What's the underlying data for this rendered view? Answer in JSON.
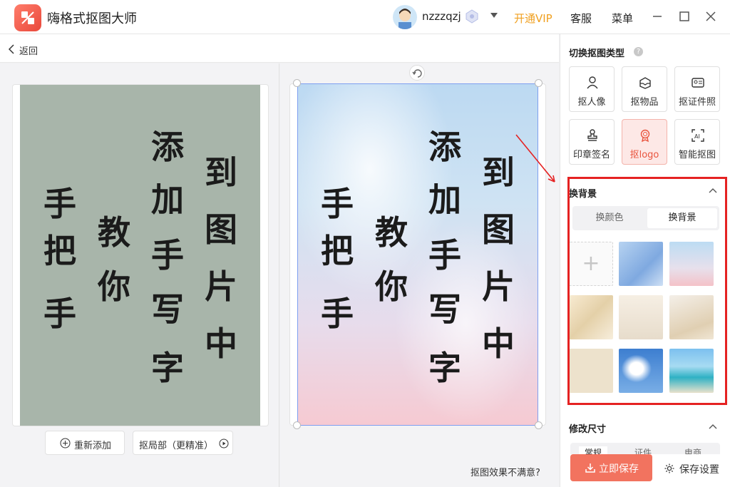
{
  "app": {
    "title": "嗨格式抠图大师",
    "username": "nzzzqzj",
    "vip_label": "开通VIP",
    "service_label": "客服",
    "menu_label": "菜单"
  },
  "nav": {
    "back_label": "返回"
  },
  "canvas": {
    "original_text": {
      "col1": [
        "手",
        "把",
        "手"
      ],
      "col2": [
        "教",
        "你"
      ],
      "col3": [
        "添",
        "加",
        "手",
        "写",
        "字"
      ],
      "col4": [
        "到",
        "图",
        "片",
        "中"
      ]
    },
    "readd_label": "重新添加",
    "local_label": "抠局部（更精准）",
    "unsatisfied_label": "抠图效果不满意?"
  },
  "sidebar": {
    "type_title": "切换抠图类型",
    "types": [
      {
        "label": "抠人像",
        "icon": "person-icon"
      },
      {
        "label": "抠物品",
        "icon": "box-icon"
      },
      {
        "label": "抠证件照",
        "icon": "id-card-icon"
      },
      {
        "label": "印章签名",
        "icon": "stamp-icon"
      },
      {
        "label": "抠logo",
        "icon": "badge-icon",
        "active": true
      },
      {
        "label": "智能抠图",
        "icon": "ai-icon"
      }
    ],
    "bg_title": "换背景",
    "tabs": [
      "换颜色",
      "换背景"
    ],
    "active_tab": "换背景",
    "size_title": "修改尺寸",
    "size_tabs": [
      "常规",
      "证件",
      "电商"
    ],
    "save_label": "立即保存",
    "save_settings_label": "保存设置"
  },
  "colors": {
    "accent": "#f2735f",
    "vip": "#f0a020",
    "highlight_box": "#e52222",
    "original_bg": "#a8b5aa"
  }
}
